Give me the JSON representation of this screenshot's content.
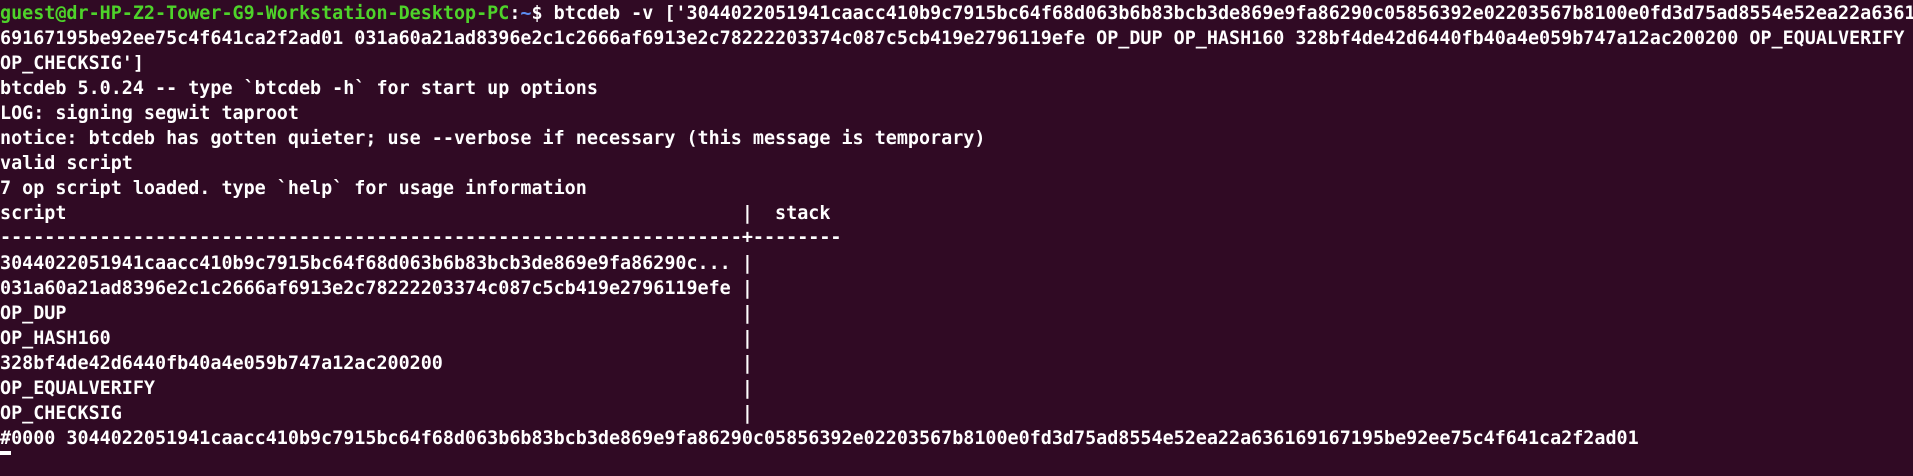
{
  "prompt": {
    "user_host": "guest@dr-HP-Z2-Tower-G9-Workstation-Desktop-PC",
    "colon": ":",
    "cwd": "~",
    "dollar": "$ "
  },
  "command": {
    "line1": "btcdeb -v ['3044022051941caacc410b9c7915bc64f68d063b6b83bcb3de869e9fa86290c05856392e02203567b8100e0fd3d75ad8554e52ea22a6361",
    "line2": "69167195be92ee75c4f641ca2f2ad01 031a60a21ad8396e2c1c2666af6913e2c78222203374c087c5cb419e2796119efe OP_DUP OP_HASH160 328bf4de42d6440fb40a4e059b747a12ac200200 OP_EQUALVERIFY",
    "line3": "OP_CHECKSIG']"
  },
  "output": {
    "version": "btcdeb 5.0.24 -- type `btcdeb -h` for start up options",
    "log": "LOG: signing segwit taproot",
    "notice": "notice: btcdeb has gotten quieter; use --verbose if necessary (this message is temporary)",
    "valid": "valid script",
    "loaded": "7 op script loaded. type `help` for usage information"
  },
  "table": {
    "header": "script                                                             |  stack",
    "separator": "-------------------------------------------------------------------+--------",
    "rows": [
      "3044022051941caacc410b9c7915bc64f68d063b6b83bcb3de869e9fa86290c... |",
      "031a60a21ad8396e2c1c2666af6913e2c78222203374c087c5cb419e2796119efe |",
      "OP_DUP                                                             |",
      "OP_HASH160                                                         |",
      "328bf4de42d6440fb40a4e059b747a12ac200200                           |",
      "OP_EQUALVERIFY                                                     |",
      "OP_CHECKSIG                                                        |"
    ]
  },
  "step": "#0000 3044022051941caacc410b9c7915bc64f68d063b6b83bcb3de869e9fa86290c05856392e02203567b8100e0fd3d75ad8554e52ea22a636169167195be92ee75c4f641ca2f2ad01",
  "colors": {
    "background": "#300a24",
    "user_host": "#4ed32a",
    "cwd": "#5b8cf0",
    "text": "#ffffff"
  }
}
